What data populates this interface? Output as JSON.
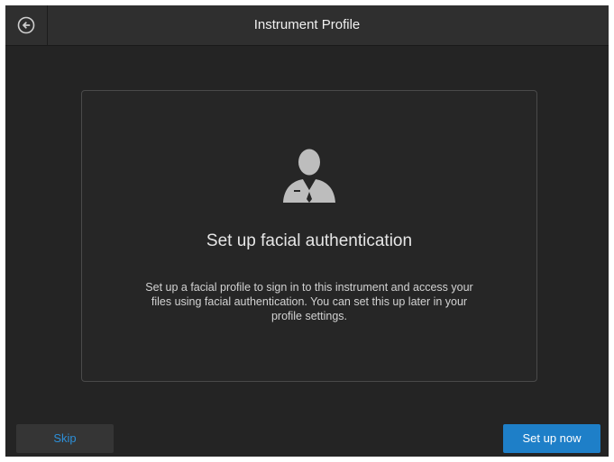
{
  "header": {
    "title": "Instrument Profile",
    "back_icon": "arrow-left-circle-icon"
  },
  "card": {
    "icon": "user-profile-icon",
    "heading": "Set up facial authentication",
    "description": "Set up a facial profile to sign in to this instrument and access your files using facial authentication. You can set this up later in your profile settings."
  },
  "footer": {
    "skip_label": "Skip",
    "setup_label": "Set up now"
  },
  "colors": {
    "background": "#242424",
    "header": "#2f2f2f",
    "accent": "#1e7fc8",
    "skip_text": "#2d8fd8"
  }
}
